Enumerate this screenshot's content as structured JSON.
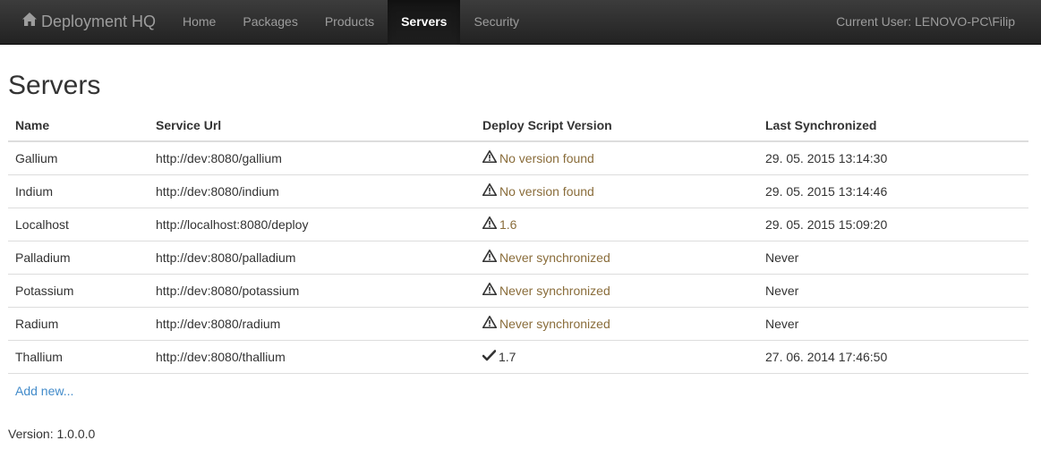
{
  "navbar": {
    "brand": "Deployment HQ",
    "brand_icon": "home-icon",
    "items": [
      {
        "label": "Home",
        "active": false
      },
      {
        "label": "Packages",
        "active": false
      },
      {
        "label": "Products",
        "active": false
      },
      {
        "label": "Servers",
        "active": true
      },
      {
        "label": "Security",
        "active": false
      }
    ],
    "current_user": "Current User: LENOVO-PC\\Filip"
  },
  "page": {
    "title": "Servers",
    "columns": [
      "Name",
      "Service Url",
      "Deploy Script Version",
      "Last Synchronized"
    ],
    "rows": [
      {
        "name": "Gallium",
        "url": "http://dev:8080/gallium",
        "version": "No version found",
        "status": "warning",
        "last_sync": "29. 05. 2015 13:14:30"
      },
      {
        "name": "Indium",
        "url": "http://dev:8080/indium",
        "version": "No version found",
        "status": "warning",
        "last_sync": "29. 05. 2015 13:14:46"
      },
      {
        "name": "Localhost",
        "url": "http://localhost:8080/deploy",
        "version": "1.6",
        "status": "warning",
        "last_sync": "29. 05. 2015 15:09:20"
      },
      {
        "name": "Palladium",
        "url": "http://dev:8080/palladium",
        "version": "Never synchronized",
        "status": "warning",
        "last_sync": "Never"
      },
      {
        "name": "Potassium",
        "url": "http://dev:8080/potassium",
        "version": "Never synchronized",
        "status": "warning",
        "last_sync": "Never"
      },
      {
        "name": "Radium",
        "url": "http://dev:8080/radium",
        "version": "Never synchronized",
        "status": "warning",
        "last_sync": "Never"
      },
      {
        "name": "Thallium",
        "url": "http://dev:8080/thallium",
        "version": "1.7",
        "status": "ok",
        "last_sync": "27. 06. 2014 17:46:50"
      }
    ],
    "add_new": "Add new..."
  },
  "footer": {
    "version": "Version: 1.0.0.0"
  },
  "colors": {
    "navbar_bg": "#222222",
    "navbar_text": "#9d9d9d",
    "active_text": "#ffffff",
    "warning_text": "#8a6d3b",
    "link": "#428bca",
    "border": "#dddddd"
  },
  "icons": {
    "warning": "warning-sign-icon",
    "ok": "checkmark-icon"
  }
}
